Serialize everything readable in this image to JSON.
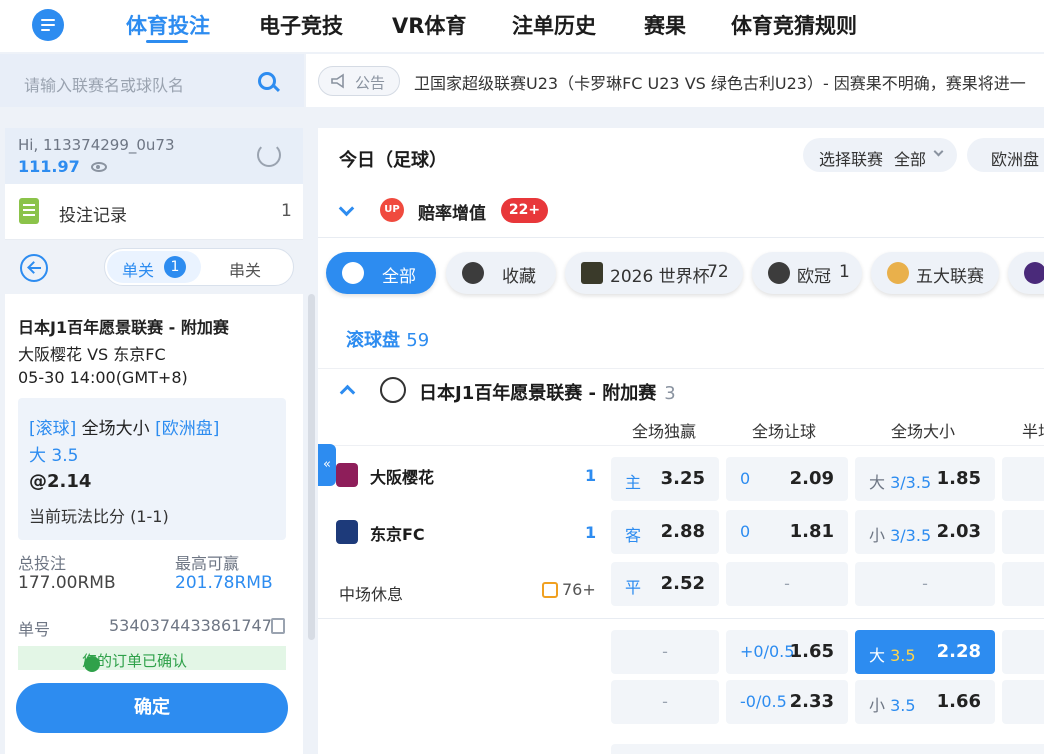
{
  "nav": {
    "items": [
      "体育投注",
      "电子竞技",
      "VR体育",
      "注单历史",
      "赛果",
      "体育竞猜规则"
    ],
    "active_index": 0
  },
  "search": {
    "placeholder": "请输入联赛名或球队名"
  },
  "notice": {
    "label": "公告",
    "text": "卫国家超级联赛U23（卡罗琳FC U23 VS 绿色古利U23）- 因赛果不明确，赛果将进一"
  },
  "account": {
    "username": "Hi, 113374299_0u73",
    "balance": "111.97"
  },
  "bet_record": {
    "label": "投注记录",
    "count": "1"
  },
  "bet_mode": {
    "single_label": "单关",
    "single_count": "1",
    "multi_label": "串关"
  },
  "bet_slip": {
    "league": "日本J1百年愿景联赛 - 附加赛",
    "match": "大阪樱花 VS 东京FC",
    "time": "05-30 14:00(GMT+8)",
    "tag_rolling": "[滚球]",
    "market": "全场大小",
    "tag_odds_type": "[欧洲盘]",
    "selection": "大 3.5",
    "odds": "@2.14",
    "current_score": "当前玩法比分 (1-1)",
    "stake_label": "总投注",
    "stake_value": "177.00RMB",
    "max_win_label": "最高可赢",
    "max_win_value": "201.78RMB",
    "ticket_label": "单号",
    "ticket_value": "5340374433861747",
    "status": "您的订单已确认",
    "confirm_label": "确定"
  },
  "main": {
    "title": "今日（足球）",
    "league_filter_label": "选择联赛",
    "league_filter_value": "全部",
    "odds_format": "欧洲盘",
    "boost_label": "赔率增值",
    "boost_icon_text": "UP",
    "boost_count": "22+",
    "categories": [
      {
        "label": "全部",
        "count": ""
      },
      {
        "label": "收藏",
        "count": ""
      },
      {
        "label": "2026 世界杯",
        "count": "72"
      },
      {
        "label": "欧冠",
        "count": "1"
      },
      {
        "label": "五大联赛",
        "count": ""
      }
    ],
    "rolling_label": "滚球盘",
    "rolling_count": "59",
    "league_name": "日本J1百年愿景联赛 - 附加赛",
    "league_count": "3",
    "col_headers": [
      "全场独赢",
      "全场让球",
      "全场大小",
      "半场"
    ]
  },
  "match": {
    "home": {
      "name": "大阪樱花",
      "score": "1"
    },
    "away": {
      "name": "东京FC",
      "score": "1"
    },
    "status": "中场休息",
    "more_count": "76+",
    "moneyline": [
      {
        "label": "主",
        "odds": "3.25"
      },
      {
        "label": "客",
        "odds": "2.88"
      },
      {
        "label": "平",
        "odds": "2.52"
      }
    ],
    "handicap": [
      {
        "line": "0",
        "odds": "2.09"
      },
      {
        "line": "0",
        "odds": "1.81"
      },
      {
        "line": "-",
        "odds": ""
      },
      {
        "line": "+0/0.5",
        "odds": "1.65"
      },
      {
        "line": "-0/0.5",
        "odds": "2.33"
      }
    ],
    "totals": [
      {
        "side": "大",
        "line": "3/3.5",
        "odds": "1.85"
      },
      {
        "side": "小",
        "line": "3/3.5",
        "odds": "2.03"
      },
      {
        "side": "-",
        "line": "",
        "odds": ""
      },
      {
        "side": "大",
        "line": "3.5",
        "odds": "2.28"
      },
      {
        "side": "小",
        "line": "3.5",
        "odds": "1.66"
      }
    ],
    "extra_moneyline_placeholder": "-"
  },
  "colors": {
    "accent": "#2d8cf0",
    "danger": "#e8373a",
    "success": "#2fa14a"
  }
}
